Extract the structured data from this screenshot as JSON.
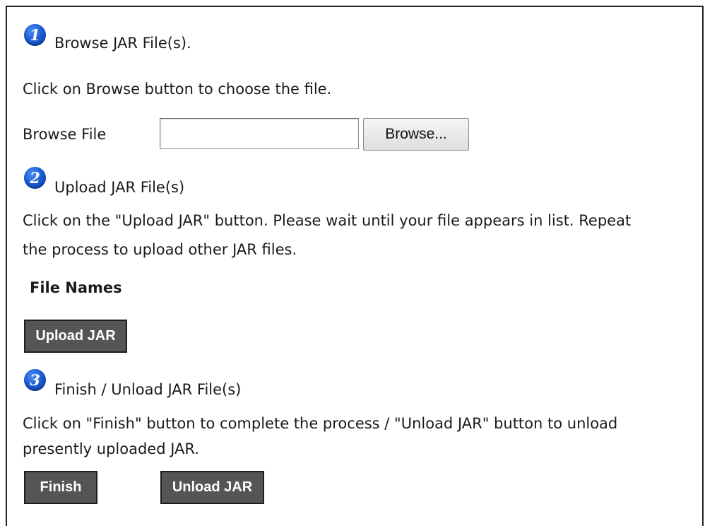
{
  "steps": [
    {
      "number": "1",
      "title": "Browse JAR File(s).",
      "description": "Click on Browse button to choose the file."
    },
    {
      "number": "2",
      "title": "Upload JAR File(s)",
      "description_line1": "Click on the \"Upload JAR\" button. Please wait until your file appears in list. Repeat",
      "description_line2": "the process to upload other JAR files."
    },
    {
      "number": "3",
      "title": "Finish / Unload JAR File(s)",
      "description_line1": "Click on \"Finish\" button to complete the process / \"Unload JAR\" button to unload",
      "description_line2": "presently uploaded JAR."
    }
  ],
  "browse": {
    "label": "Browse File",
    "value": "",
    "button_label": "Browse..."
  },
  "file_list": {
    "heading": "File Names"
  },
  "buttons": {
    "upload": "Upload JAR",
    "finish": "Finish",
    "unload": "Unload JAR"
  }
}
